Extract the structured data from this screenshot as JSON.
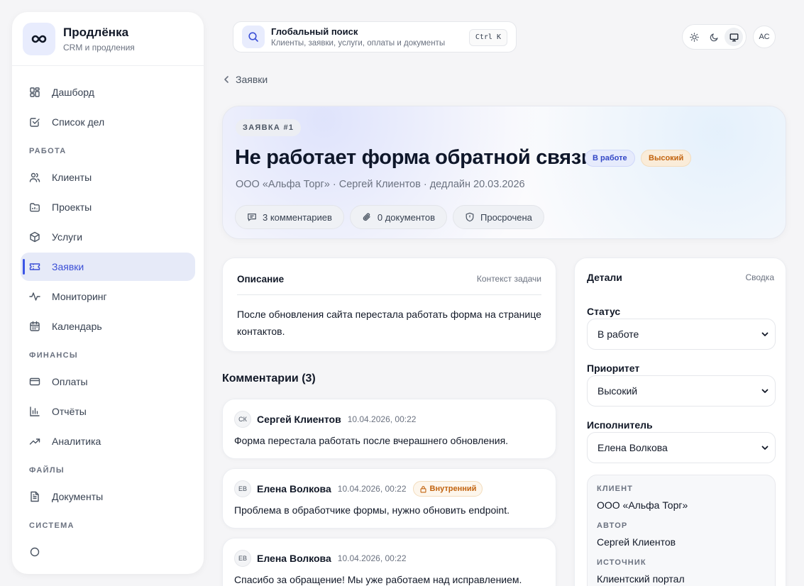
{
  "brand": {
    "name": "Продлёнка",
    "subtitle": "CRM и продления"
  },
  "sidebar": {
    "items_top": [
      {
        "label": "Дашборд",
        "icon": "dashboard-icon"
      },
      {
        "label": "Список дел",
        "icon": "checklist-icon"
      }
    ],
    "section_work": "РАБОТА",
    "items_work": [
      {
        "label": "Клиенты",
        "icon": "users-icon"
      },
      {
        "label": "Проекты",
        "icon": "folder-icon"
      },
      {
        "label": "Услуги",
        "icon": "box-icon"
      },
      {
        "label": "Заявки",
        "icon": "ticket-icon",
        "active": true
      },
      {
        "label": "Мониторинг",
        "icon": "activity-icon"
      },
      {
        "label": "Календарь",
        "icon": "calendar-icon"
      }
    ],
    "section_finance": "ФИНАНСЫ",
    "items_finance": [
      {
        "label": "Оплаты",
        "icon": "credit-card-icon"
      },
      {
        "label": "Отчёты",
        "icon": "bar-chart-icon"
      },
      {
        "label": "Аналитика",
        "icon": "trend-icon"
      }
    ],
    "section_files": "ФАЙЛЫ",
    "items_files": [
      {
        "label": "Документы",
        "icon": "document-icon"
      }
    ],
    "section_system": "СИСТЕМА"
  },
  "search": {
    "title": "Глобальный поиск",
    "subtitle": "Клиенты, заявки, услуги, оплаты и документы",
    "shortcut": "Ctrl K"
  },
  "user": {
    "initials": "АС"
  },
  "breadcrumb": {
    "label": "Заявки"
  },
  "ticket": {
    "tag": "ЗАЯВКА #1",
    "title": "Не работает форма обратной связи",
    "status_badge": "В работе",
    "priority_badge": "Высокий",
    "meta": "ООО «Альфа Торг» · Сергей Клиентов · дедлайн 20.03.2026",
    "chips": {
      "comments": "3 комментариев",
      "documents": "0 документов",
      "overdue": "Просрочена"
    }
  },
  "description": {
    "title": "Описание",
    "context": "Контекст задачи",
    "text": "После обновления сайта перестала работать форма на странице контактов."
  },
  "comments": {
    "title": "Комментарии (3)",
    "items": [
      {
        "initials": "СК",
        "author": "Сергей Клиентов",
        "date": "10.04.2026, 00:22",
        "text": "Форма перестала работать после вчерашнего обновления."
      },
      {
        "initials": "ЕВ",
        "author": "Елена Волкова",
        "date": "10.04.2026, 00:22",
        "badge": "Внутренний",
        "text": "Проблема в обработчике формы, нужно обновить endpoint."
      },
      {
        "initials": "ЕВ",
        "author": "Елена Волкова",
        "date": "10.04.2026, 00:22",
        "text": "Спасибо за обращение! Мы уже работаем над исправлением."
      }
    ]
  },
  "details": {
    "title": "Детали",
    "subtitle": "Сводка",
    "status_label": "Статус",
    "status_value": "В работе",
    "priority_label": "Приоритет",
    "priority_value": "Высокий",
    "assignee_label": "Исполнитель",
    "assignee_value": "Елена Волкова",
    "client_label": "КЛИЕНТ",
    "client_value": "ООО «Альфа Торг»",
    "author_label": "АВТОР",
    "author_value": "Сергей Клиентов",
    "source_label": "ИСТОЧНИК",
    "source_value": "Клиентский портал"
  },
  "colors": {
    "accent": "#3b4fd6",
    "status_badge": "#3347c6",
    "priority_badge": "#c2630e",
    "background": "#f5f5f7"
  }
}
